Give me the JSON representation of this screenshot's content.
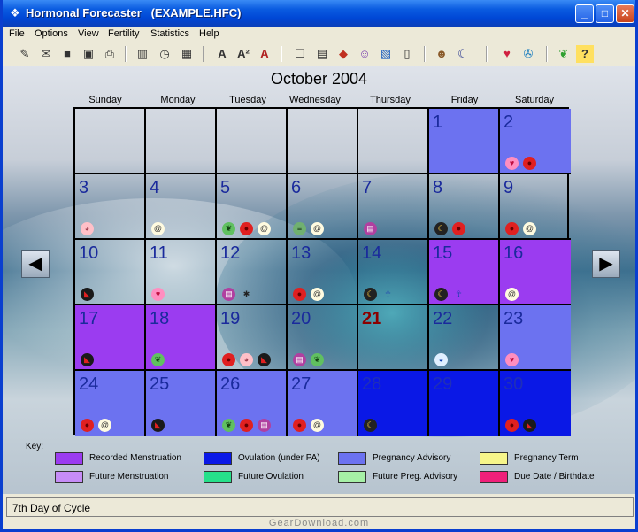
{
  "window": {
    "title": "Hormonal Forecaster   (EXAMPLE.HFC)",
    "minimize": "_",
    "maximize": "□",
    "close": "✕"
  },
  "menu": [
    "File",
    "Options",
    "View",
    "Fertility",
    "Statistics",
    "Help"
  ],
  "toolbar": {
    "buttons": [
      "new-icon",
      "open-icon",
      "save-icon",
      "save-as-icon",
      "print-icon",
      "calculator-icon",
      "clock-icon",
      "calendar-grid-icon",
      "font-icon",
      "font-size-icon",
      "font-color-icon",
      "notes-icon",
      "book-icon",
      "cube-icon",
      "mask-icon",
      "picture-icon",
      "thermometer-icon",
      "person-icon",
      "moon-icon",
      "heart-icon",
      "lifebuoy-icon",
      "frog-icon",
      "help-icon"
    ]
  },
  "calendar": {
    "month_title": "October 2004",
    "weekdays": [
      "Sunday",
      "Monday",
      "Tuesday",
      "Wednesday",
      "Thursday",
      "Friday",
      "Saturday"
    ],
    "today": "21",
    "days": [
      {
        "n": "",
        "type": "none",
        "icons": []
      },
      {
        "n": "",
        "type": "none",
        "icons": []
      },
      {
        "n": "",
        "type": "none",
        "icons": []
      },
      {
        "n": "",
        "type": "none",
        "icons": []
      },
      {
        "n": "",
        "type": "none",
        "icons": []
      },
      {
        "n": "1",
        "type": "preg",
        "icons": []
      },
      {
        "n": "2",
        "type": "preg",
        "icons": [
          "heart",
          "lips"
        ]
      },
      {
        "n": "3",
        "type": "none",
        "icons": [
          "pig"
        ]
      },
      {
        "n": "4",
        "type": "none",
        "icons": [
          "swirl"
        ]
      },
      {
        "n": "5",
        "type": "none",
        "icons": [
          "frog",
          "lips",
          "swirl"
        ]
      },
      {
        "n": "6",
        "type": "none",
        "icons": [
          "chat",
          "swirl"
        ]
      },
      {
        "n": "7",
        "type": "none",
        "icons": [
          "book"
        ]
      },
      {
        "n": "8",
        "type": "none",
        "icons": [
          "moon",
          "lips"
        ]
      },
      {
        "n": "9",
        "type": "none",
        "icons": [
          "lips",
          "swirl"
        ]
      },
      {
        "n": "10",
        "type": "none",
        "icons": [
          "flag"
        ]
      },
      {
        "n": "11",
        "type": "none",
        "icons": [
          "heart"
        ]
      },
      {
        "n": "12",
        "type": "none",
        "icons": [
          "book",
          "spider"
        ]
      },
      {
        "n": "13",
        "type": "none",
        "icons": [
          "lips",
          "swirl"
        ]
      },
      {
        "n": "14",
        "type": "none",
        "icons": [
          "moon",
          "figure"
        ]
      },
      {
        "n": "15",
        "type": "menst",
        "icons": [
          "moon",
          "figure"
        ]
      },
      {
        "n": "16",
        "type": "menst",
        "icons": [
          "swirl"
        ]
      },
      {
        "n": "17",
        "type": "menst",
        "icons": [
          "flag"
        ]
      },
      {
        "n": "18",
        "type": "menst",
        "icons": [
          "frog"
        ]
      },
      {
        "n": "19",
        "type": "none",
        "icons": [
          "lips",
          "pig",
          "flag"
        ]
      },
      {
        "n": "20",
        "type": "none",
        "icons": [
          "book",
          "frog"
        ]
      },
      {
        "n": "21",
        "type": "none",
        "icons": []
      },
      {
        "n": "22",
        "type": "none",
        "icons": [
          "drum"
        ]
      },
      {
        "n": "23",
        "type": "preg",
        "icons": [
          "heart"
        ]
      },
      {
        "n": "24",
        "type": "preg",
        "icons": [
          "lips",
          "swirl"
        ]
      },
      {
        "n": "25",
        "type": "preg",
        "icons": [
          "flag"
        ]
      },
      {
        "n": "26",
        "type": "preg",
        "icons": [
          "frog",
          "lips",
          "book"
        ]
      },
      {
        "n": "27",
        "type": "preg",
        "icons": [
          "lips",
          "swirl"
        ]
      },
      {
        "n": "28",
        "type": "ovul",
        "icons": [
          "moon"
        ]
      },
      {
        "n": "29",
        "type": "ovul",
        "icons": []
      },
      {
        "n": "30",
        "type": "ovul",
        "icons": [
          "lips",
          "flag"
        ]
      }
    ]
  },
  "key": {
    "label": "Key:",
    "items": [
      {
        "label": "Recorded Menstruation",
        "color": "#9b3cf0"
      },
      {
        "label": "Ovulation (under PA)",
        "color": "#0a18e6"
      },
      {
        "label": "Pregnancy Advisory",
        "color": "#6c72f0"
      },
      {
        "label": "Pregnancy Term",
        "color": "#f6f58a"
      },
      {
        "label": "Future Menstruation",
        "color": "#c68cf7"
      },
      {
        "label": "Future Ovulation",
        "color": "#26e08a"
      },
      {
        "label": "Future Preg. Advisory",
        "color": "#a6f0a6"
      },
      {
        "label": "Due Date / Birthdate",
        "color": "#f0207a"
      }
    ]
  },
  "status": "7th Day of Cycle",
  "watermark": "GearDownload.com",
  "colors": {
    "menst": "#9b3cf0",
    "preg": "#6c72f0",
    "ovul": "#0a18e6",
    "day_number": "#1a2a9c",
    "today_number": "#8b0000"
  }
}
